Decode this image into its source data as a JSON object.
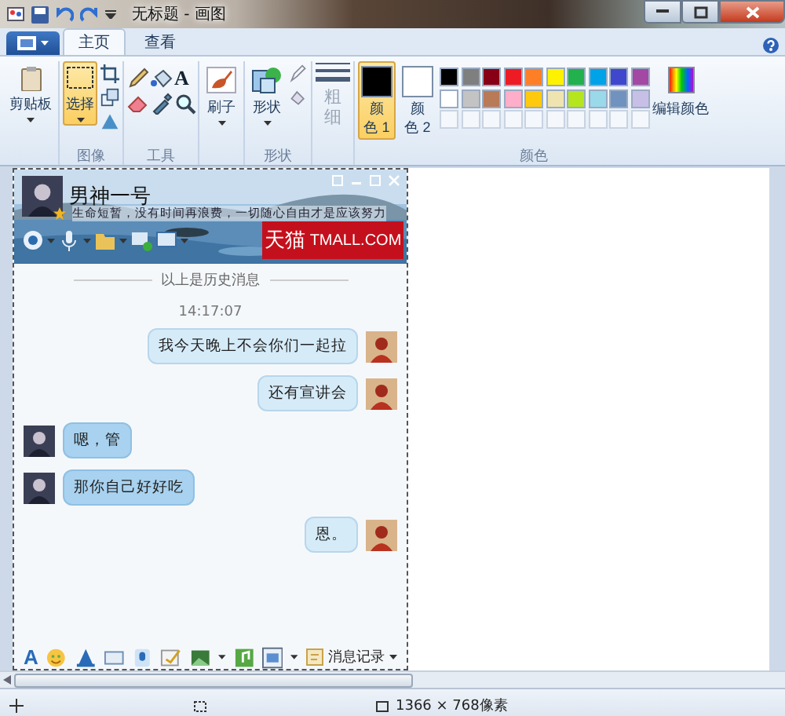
{
  "window": {
    "title": "无标题 - 画图"
  },
  "ribbon": {
    "tabs": [
      {
        "label": "主页",
        "selected": true
      },
      {
        "label": "查看",
        "selected": false
      }
    ],
    "clipboard": {
      "label": "剪贴板"
    },
    "image_group": {
      "label": "图像",
      "select": {
        "label": "选择",
        "selected": true
      }
    },
    "tools_group": {
      "label": "工具",
      "text_tool": "A"
    },
    "brush": {
      "label": "刷子"
    },
    "shapes_group": {
      "label": "形状",
      "button": "形状"
    },
    "size": {
      "label": "粗细",
      "disabled": true
    },
    "colors_group": {
      "label": "颜色",
      "color1": {
        "label": "颜色 1",
        "selected": true,
        "color": "#000000"
      },
      "color2": {
        "label": "颜色 2",
        "selected": false,
        "color": "#ffffff"
      },
      "palette": [
        {
          "color": "#000000"
        },
        {
          "color": "#7f7f7f"
        },
        {
          "color": "#880015"
        },
        {
          "color": "#ed1c24"
        },
        {
          "color": "#ff7f27"
        },
        {
          "color": "#fff200"
        },
        {
          "color": "#22b14c"
        },
        {
          "color": "#00a2e8"
        },
        {
          "color": "#3f48cc"
        },
        {
          "color": "#a349a4"
        },
        {
          "color": "#ffffff"
        },
        {
          "color": "#c3c3c3"
        },
        {
          "color": "#b97a57"
        },
        {
          "color": "#ffaec9"
        },
        {
          "color": "#ffc90e"
        },
        {
          "color": "#efe4b0"
        },
        {
          "color": "#b5e61d"
        },
        {
          "color": "#99d9ea"
        },
        {
          "color": "#7092be"
        },
        {
          "color": "#c8bfe7"
        }
      ],
      "edit_colors": "编辑颜色"
    }
  },
  "chat": {
    "name": "男神一号",
    "status": "生命短暂，没有时间再浪费，一切随心自由才是应该努力",
    "font_button": "A",
    "ad": "天猫",
    "ad_domain": "TMALL.COM",
    "history_note": "以上是历史消息",
    "time": "14:17:07",
    "messages": [
      {
        "kind": "sent",
        "text": "我今天晚上不会你们一起拉"
      },
      {
        "kind": "sent",
        "text": "还有宣讲会"
      },
      {
        "kind": "received",
        "text": "嗯，管"
      },
      {
        "kind": "received",
        "text": "那你自己好好吃"
      },
      {
        "kind": "sent",
        "text": "恩。"
      }
    ],
    "history_button": "消息记录"
  },
  "status_bar": {
    "image_size": "1366 × 768像素"
  }
}
